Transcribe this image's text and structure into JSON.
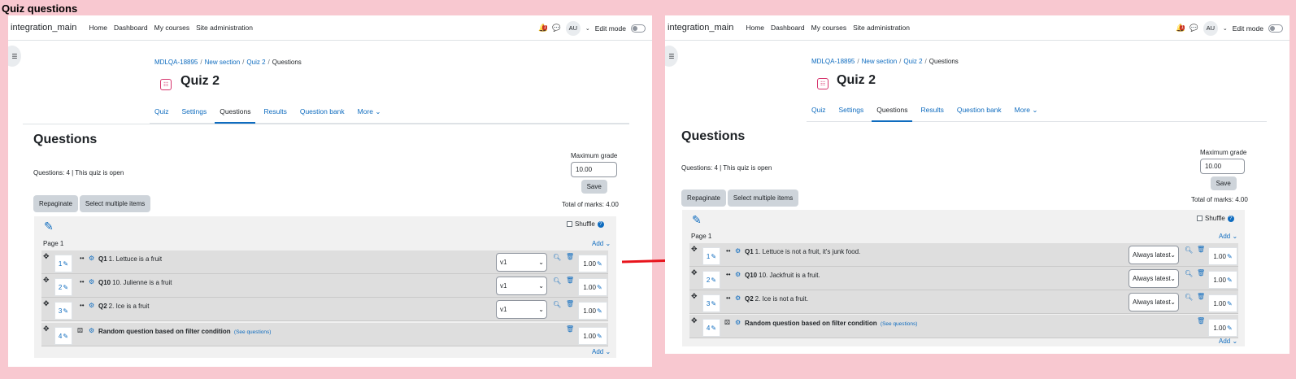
{
  "heading": "Quiz questions",
  "nav": {
    "brand": "integration_main",
    "links": [
      "Home",
      "Dashboard",
      "My courses",
      "Site administration"
    ],
    "notif_count": "1",
    "avatar": "AU",
    "edit_mode": "Edit mode"
  },
  "breadcrumb": [
    "MDLQA-18895",
    "New section",
    "Quiz 2",
    "Questions"
  ],
  "quiz_title": "Quiz 2",
  "tabs": [
    "Quiz",
    "Settings",
    "Questions",
    "Results",
    "Question bank",
    "More"
  ],
  "section_title": "Questions",
  "quiz_info": "Questions: 4 | This quiz is open",
  "max_grade": {
    "label": "Maximum grade",
    "value": "10.00",
    "save": "Save"
  },
  "buttons": {
    "repaginate": "Repaginate",
    "select_multiple": "Select multiple items"
  },
  "total_marks": "Total of marks: 4.00",
  "shuffle_label": "Shuffle",
  "page_label": "Page 1",
  "add_label": "Add",
  "see_questions": "(See questions)",
  "left_questions": [
    {
      "num": "1",
      "id": "Q1",
      "text": "1. Lettuce is a fruit",
      "version": "v1",
      "mark": "1.00"
    },
    {
      "num": "2",
      "id": "Q10",
      "text": "10. Julienne is a fruit",
      "version": "v1",
      "mark": "1.00"
    },
    {
      "num": "3",
      "id": "Q2",
      "text": "2. Ice is a fruit",
      "version": "v1",
      "mark": "1.00"
    },
    {
      "num": "4",
      "id": "",
      "text": "Random question based on filter condition",
      "version": "",
      "mark": "1.00"
    }
  ],
  "right_questions": [
    {
      "num": "1",
      "id": "Q1",
      "text": "1. Lettuce is not a fruit, it's junk food.",
      "version": "Always latest",
      "mark": "1.00"
    },
    {
      "num": "2",
      "id": "Q10",
      "text": "10. Jackfruit is a fruit.",
      "version": "Always latest",
      "mark": "1.00"
    },
    {
      "num": "3",
      "id": "Q2",
      "text": "2. Ice is not a fruit.",
      "version": "Always latest",
      "mark": "1.00"
    },
    {
      "num": "4",
      "id": "",
      "text": "Random question based on filter condition",
      "version": "",
      "mark": "1.00"
    }
  ],
  "colors": {
    "background": "#f8c8d0",
    "link": "#0f6cbf",
    "arrow": "#e8141c"
  }
}
